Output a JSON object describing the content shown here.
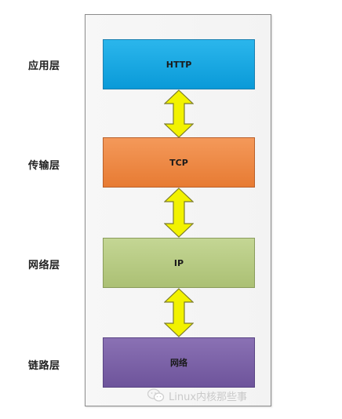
{
  "layers": [
    {
      "name": "应用层",
      "protocol": "HTTP"
    },
    {
      "name": "传输层",
      "protocol": "TCP"
    },
    {
      "name": "网络层",
      "protocol": "IP"
    },
    {
      "name": "链路层",
      "protocol": "网络"
    }
  ],
  "watermark": {
    "text": "Linux内核那些事",
    "icon": "wechat-icon"
  },
  "colors": {
    "http": "#0a9ad8",
    "tcp": "#e77b33",
    "ip": "#abc074",
    "link": "#6e549b",
    "arrow_fill": "#f2f200",
    "arrow_stroke": "#7d7d2a"
  }
}
